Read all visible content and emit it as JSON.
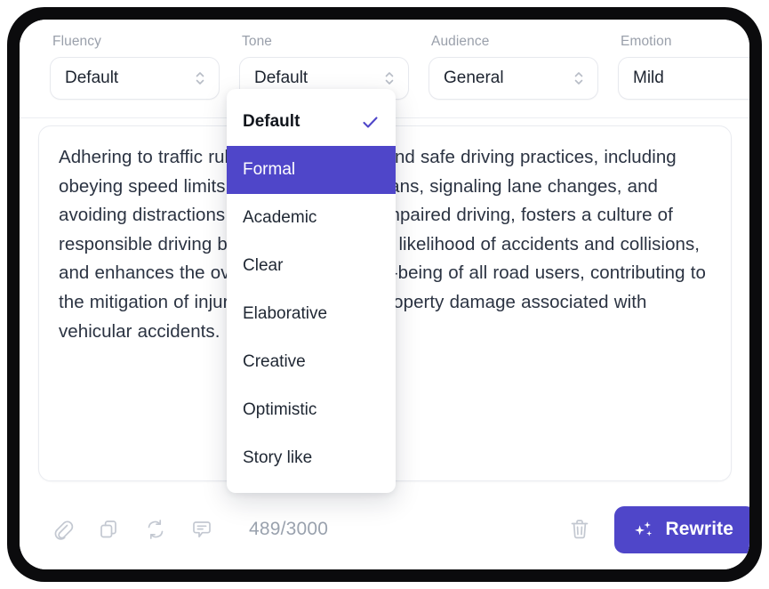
{
  "controls": [
    {
      "label": "Fluency",
      "value": "Default",
      "icon": "chevron-updown-icon"
    },
    {
      "label": "Tone",
      "value": "Default",
      "icon": "chevron-updown-icon"
    },
    {
      "label": "Audience",
      "value": "General",
      "icon": "chevron-updown-icon"
    },
    {
      "label": "Emotion",
      "value": "Mild",
      "icon": "chevron-updown-icon"
    }
  ],
  "tone_menu": {
    "open_for": "Tone",
    "selected": "Default",
    "highlighted": "Formal",
    "check_icon": "check-icon",
    "items": [
      {
        "label": "Default"
      },
      {
        "label": "Formal"
      },
      {
        "label": "Academic"
      },
      {
        "label": "Clear"
      },
      {
        "label": "Elaborative"
      },
      {
        "label": "Creative"
      },
      {
        "label": "Optimistic"
      },
      {
        "label": "Story like"
      }
    ]
  },
  "editor": {
    "text": "Adhering to traffic rules and regulations and safe driving practices, including obeying speed limits, yielding to pedestrians, signaling lane changes, and avoiding distractions such as texting or impaired driving, fosters a culture of responsible driving behavior, reduces the likelihood of accidents and collisions, and enhances the overall safety and well-being of all road users, contributing to the mitigation of injuries, fatalities, and property damage associated with vehicular accidents."
  },
  "toolbar": {
    "icons": [
      {
        "name": "attach-icon",
        "title": "Attach"
      },
      {
        "name": "copy-icon",
        "title": "Copy"
      },
      {
        "name": "sync-icon",
        "title": "Regenerate"
      },
      {
        "name": "comment-icon",
        "title": "Comment"
      }
    ],
    "counter": "489/3000",
    "char_count": 489,
    "char_limit": 3000,
    "delete_icon": "trash-icon",
    "rewrite_label": "Rewrite",
    "rewrite_icon": "sparkle-icon"
  },
  "colors": {
    "accent": "#4F46C9",
    "label_gray": "#9AA0AB",
    "text": "#2B3342",
    "border": "#E9EBF0",
    "bezel": "#0B0B0D"
  }
}
